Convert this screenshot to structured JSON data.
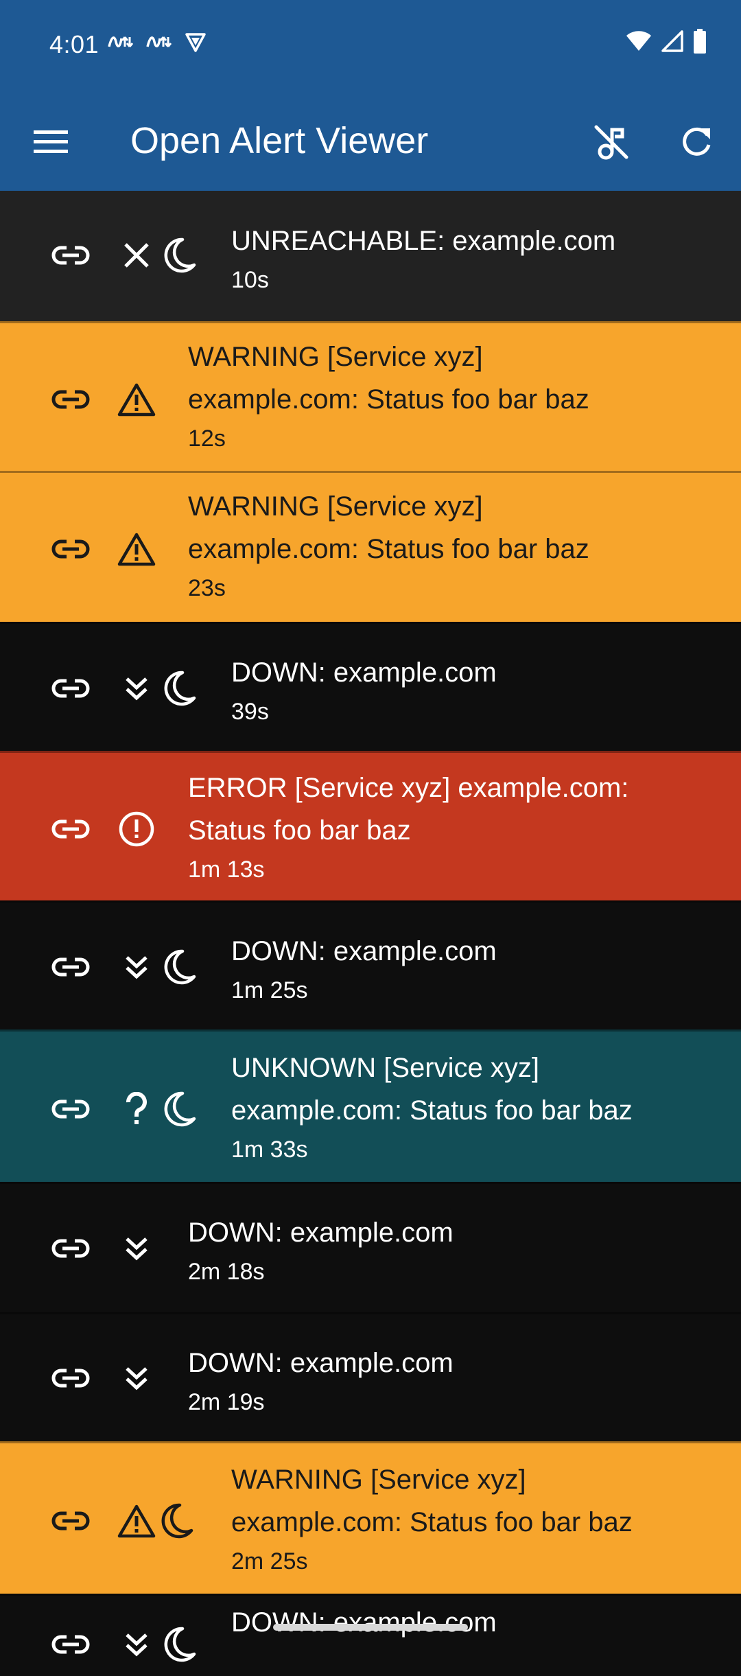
{
  "status_bar": {
    "time": "4:01",
    "icons_left": [
      "sync-icon",
      "sync-icon",
      "vpn-shield-icon"
    ],
    "icons_right": [
      "wifi-icon",
      "cellular-signal-icon",
      "battery-icon"
    ]
  },
  "app_bar": {
    "title": "Open Alert Viewer",
    "menu_icon": "menu-icon",
    "action_icons": [
      "music-note-off-icon",
      "refresh-icon"
    ]
  },
  "colors": {
    "app_bar": "#1e5994",
    "unreachable": "#222222",
    "warning": "#f7a52c",
    "down": "#0e0e0e",
    "error": "#c4381f",
    "unknown": "#124e57"
  },
  "alerts": [
    {
      "kind": "unreachable",
      "title": "UNREACHABLE: example.com",
      "age": "10s",
      "icons": [
        "close-icon",
        "moon-icon"
      ]
    },
    {
      "kind": "warning",
      "title": "WARNING [Service xyz]\nexample.com: Status foo bar baz",
      "age": "12s",
      "icons": [
        "warning-icon"
      ]
    },
    {
      "kind": "warning",
      "title": "WARNING [Service xyz]\nexample.com: Status foo bar baz",
      "age": "23s",
      "icons": [
        "warning-icon"
      ]
    },
    {
      "kind": "down",
      "title": "DOWN: example.com",
      "age": "39s",
      "icons": [
        "double-chevron-down-icon",
        "moon-icon"
      ]
    },
    {
      "kind": "error",
      "title": "ERROR [Service xyz] example.com:\nStatus foo bar baz",
      "age": "1m 13s",
      "icons": [
        "error-circle-icon"
      ]
    },
    {
      "kind": "down",
      "title": "DOWN: example.com",
      "age": "1m 25s",
      "icons": [
        "double-chevron-down-icon",
        "moon-icon"
      ]
    },
    {
      "kind": "unknown",
      "title": "UNKNOWN [Service xyz]\nexample.com: Status foo bar baz",
      "age": "1m 33s",
      "icons": [
        "question-icon",
        "moon-icon"
      ]
    },
    {
      "kind": "down",
      "title": "DOWN: example.com",
      "age": "2m 18s",
      "icons": [
        "double-chevron-down-icon"
      ]
    },
    {
      "kind": "down",
      "title": "DOWN: example.com",
      "age": "2m 19s",
      "icons": [
        "double-chevron-down-icon"
      ]
    },
    {
      "kind": "warning",
      "title": "WARNING [Service xyz]\nexample.com: Status foo bar baz",
      "age": "2m 25s",
      "icons": [
        "warning-icon",
        "moon-icon"
      ]
    },
    {
      "kind": "down",
      "title": "DOWN: example.com",
      "age": "",
      "icons": [
        "double-chevron-down-icon",
        "moon-icon"
      ]
    }
  ]
}
